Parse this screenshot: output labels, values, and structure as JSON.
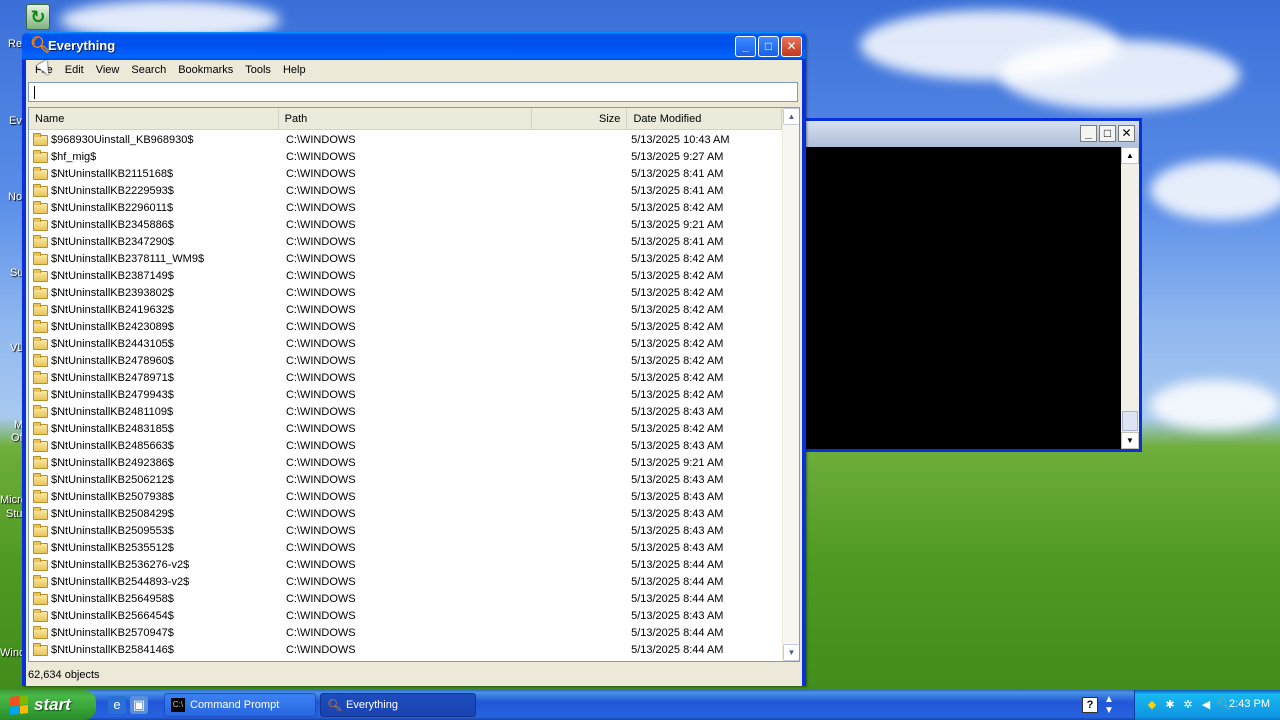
{
  "desktop": {
    "icon_labels": [
      "Re",
      "Ev",
      "No",
      "Su",
      "VL",
      "M",
      "Of",
      "Micro",
      "Stu",
      "Winc"
    ]
  },
  "window": {
    "title": "Everything",
    "buttons": {
      "minimize": "_",
      "maximize": "□",
      "close": "✕"
    }
  },
  "menu": [
    "File",
    "Edit",
    "View",
    "Search",
    "Bookmarks",
    "Tools",
    "Help"
  ],
  "search": {
    "value": "",
    "placeholder": ""
  },
  "columns": {
    "name": "Name",
    "path": "Path",
    "size": "Size",
    "date": "Date Modified"
  },
  "rows": [
    {
      "name": "$968930Uinstall_KB968930$",
      "path": "C:\\WINDOWS",
      "size": "",
      "date": "5/13/2025 10:43 AM"
    },
    {
      "name": "$hf_mig$",
      "path": "C:\\WINDOWS",
      "size": "",
      "date": "5/13/2025 9:27 AM"
    },
    {
      "name": "$NtUninstallKB2115168$",
      "path": "C:\\WINDOWS",
      "size": "",
      "date": "5/13/2025 8:41 AM"
    },
    {
      "name": "$NtUninstallKB2229593$",
      "path": "C:\\WINDOWS",
      "size": "",
      "date": "5/13/2025 8:41 AM"
    },
    {
      "name": "$NtUninstallKB2296011$",
      "path": "C:\\WINDOWS",
      "size": "",
      "date": "5/13/2025 8:42 AM"
    },
    {
      "name": "$NtUninstallKB2345886$",
      "path": "C:\\WINDOWS",
      "size": "",
      "date": "5/13/2025 9:21 AM"
    },
    {
      "name": "$NtUninstallKB2347290$",
      "path": "C:\\WINDOWS",
      "size": "",
      "date": "5/13/2025 8:41 AM"
    },
    {
      "name": "$NtUninstallKB2378111_WM9$",
      "path": "C:\\WINDOWS",
      "size": "",
      "date": "5/13/2025 8:42 AM"
    },
    {
      "name": "$NtUninstallKB2387149$",
      "path": "C:\\WINDOWS",
      "size": "",
      "date": "5/13/2025 8:42 AM"
    },
    {
      "name": "$NtUninstallKB2393802$",
      "path": "C:\\WINDOWS",
      "size": "",
      "date": "5/13/2025 8:42 AM"
    },
    {
      "name": "$NtUninstallKB2419632$",
      "path": "C:\\WINDOWS",
      "size": "",
      "date": "5/13/2025 8:42 AM"
    },
    {
      "name": "$NtUninstallKB2423089$",
      "path": "C:\\WINDOWS",
      "size": "",
      "date": "5/13/2025 8:42 AM"
    },
    {
      "name": "$NtUninstallKB2443105$",
      "path": "C:\\WINDOWS",
      "size": "",
      "date": "5/13/2025 8:42 AM"
    },
    {
      "name": "$NtUninstallKB2478960$",
      "path": "C:\\WINDOWS",
      "size": "",
      "date": "5/13/2025 8:42 AM"
    },
    {
      "name": "$NtUninstallKB2478971$",
      "path": "C:\\WINDOWS",
      "size": "",
      "date": "5/13/2025 8:42 AM"
    },
    {
      "name": "$NtUninstallKB2479943$",
      "path": "C:\\WINDOWS",
      "size": "",
      "date": "5/13/2025 8:42 AM"
    },
    {
      "name": "$NtUninstallKB2481109$",
      "path": "C:\\WINDOWS",
      "size": "",
      "date": "5/13/2025 8:43 AM"
    },
    {
      "name": "$NtUninstallKB2483185$",
      "path": "C:\\WINDOWS",
      "size": "",
      "date": "5/13/2025 8:42 AM"
    },
    {
      "name": "$NtUninstallKB2485663$",
      "path": "C:\\WINDOWS",
      "size": "",
      "date": "5/13/2025 8:43 AM"
    },
    {
      "name": "$NtUninstallKB2492386$",
      "path": "C:\\WINDOWS",
      "size": "",
      "date": "5/13/2025 9:21 AM"
    },
    {
      "name": "$NtUninstallKB2506212$",
      "path": "C:\\WINDOWS",
      "size": "",
      "date": "5/13/2025 8:43 AM"
    },
    {
      "name": "$NtUninstallKB2507938$",
      "path": "C:\\WINDOWS",
      "size": "",
      "date": "5/13/2025 8:43 AM"
    },
    {
      "name": "$NtUninstallKB2508429$",
      "path": "C:\\WINDOWS",
      "size": "",
      "date": "5/13/2025 8:43 AM"
    },
    {
      "name": "$NtUninstallKB2509553$",
      "path": "C:\\WINDOWS",
      "size": "",
      "date": "5/13/2025 8:43 AM"
    },
    {
      "name": "$NtUninstallKB2535512$",
      "path": "C:\\WINDOWS",
      "size": "",
      "date": "5/13/2025 8:43 AM"
    },
    {
      "name": "$NtUninstallKB2536276-v2$",
      "path": "C:\\WINDOWS",
      "size": "",
      "date": "5/13/2025 8:44 AM"
    },
    {
      "name": "$NtUninstallKB2544893-v2$",
      "path": "C:\\WINDOWS",
      "size": "",
      "date": "5/13/2025 8:44 AM"
    },
    {
      "name": "$NtUninstallKB2564958$",
      "path": "C:\\WINDOWS",
      "size": "",
      "date": "5/13/2025 8:44 AM"
    },
    {
      "name": "$NtUninstallKB2566454$",
      "path": "C:\\WINDOWS",
      "size": "",
      "date": "5/13/2025 8:43 AM"
    },
    {
      "name": "$NtUninstallKB2570947$",
      "path": "C:\\WINDOWS",
      "size": "",
      "date": "5/13/2025 8:44 AM"
    },
    {
      "name": "$NtUninstallKB2584146$",
      "path": "C:\\WINDOWS",
      "size": "",
      "date": "5/13/2025 8:44 AM"
    }
  ],
  "status": {
    "objects": "62,634 objects"
  },
  "taskbar": {
    "start_label": "start",
    "tasks": [
      {
        "label": "Command Prompt",
        "icon": "cmd-icon"
      },
      {
        "label": "Everything",
        "icon": "everything-icon"
      }
    ],
    "clock": "2:43 PM"
  },
  "colors": {
    "title_bar": "#0054e3",
    "start_button": "#3c9a3c",
    "tray": "#0f95e2",
    "window_face": "#ece9d8"
  }
}
